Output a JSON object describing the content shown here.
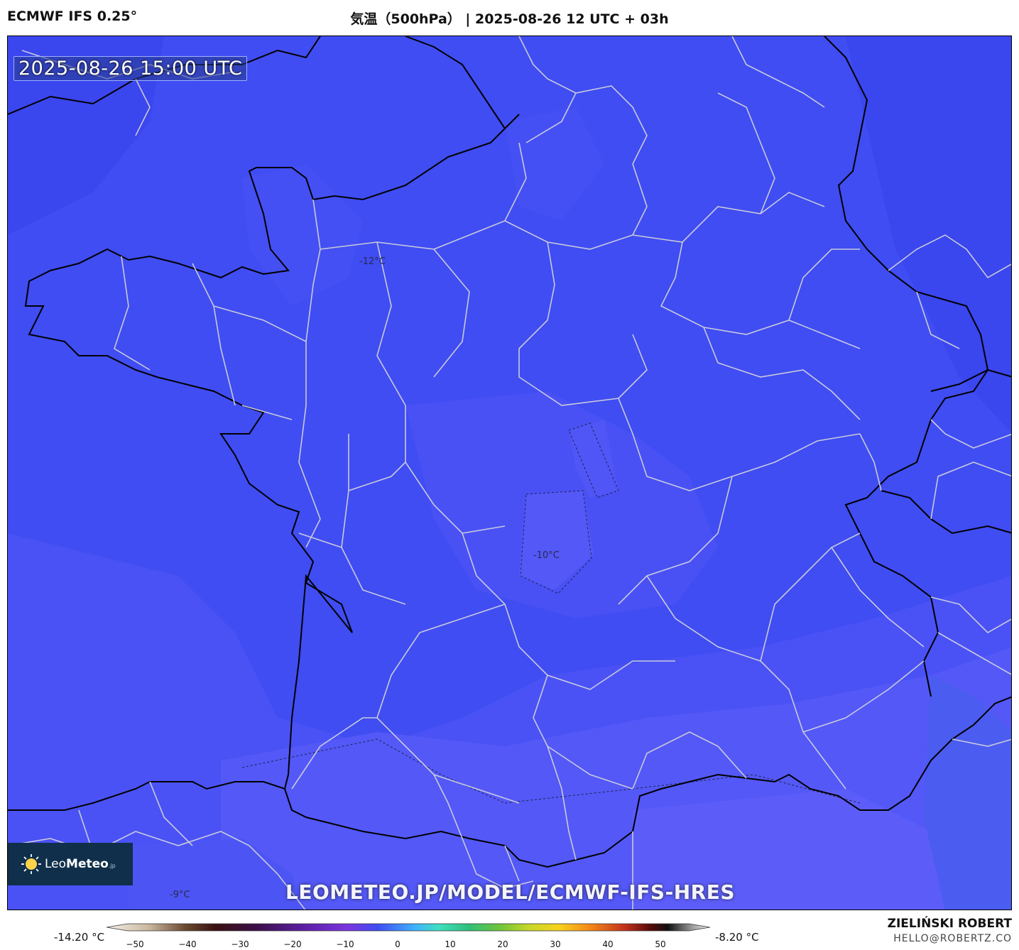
{
  "header": {
    "model": "ECMWF IFS 0.25°",
    "title": "気温（500hPa） | 2025-08-26 12 UTC + 03h"
  },
  "map": {
    "valid_time": "2025-08-26 15:00 UTC",
    "isotherm_labels": [
      "-12°C",
      "-10°C",
      "-9°C"
    ],
    "watermark": "LEOMETEO.JP/MODEL/ECMWF-IFS-HRES",
    "fill_colors": {
      "coldest": "#3a46ee",
      "cold": "#3f4df2",
      "mid": "#4851f5",
      "warm": "#5257f7",
      "warmest": "#5c5df9"
    },
    "border_color": "#c8c8d8",
    "coast_color": "#000000"
  },
  "logo": {
    "icon": "sun-icon",
    "name_light": "Leo",
    "name_bold": "Meteo",
    "suffix": ".jp"
  },
  "colorbar": {
    "min_label": "-14.20 °C",
    "max_label": "-8.20 °C",
    "ticks": [
      "−50",
      "−40",
      "−30",
      "−20",
      "−10",
      "0",
      "10",
      "20",
      "30",
      "40",
      "50"
    ]
  },
  "credit": {
    "author": "ZIELIŃSKI ROBERT",
    "email": "HELLO@ROBERTZ.CO"
  }
}
